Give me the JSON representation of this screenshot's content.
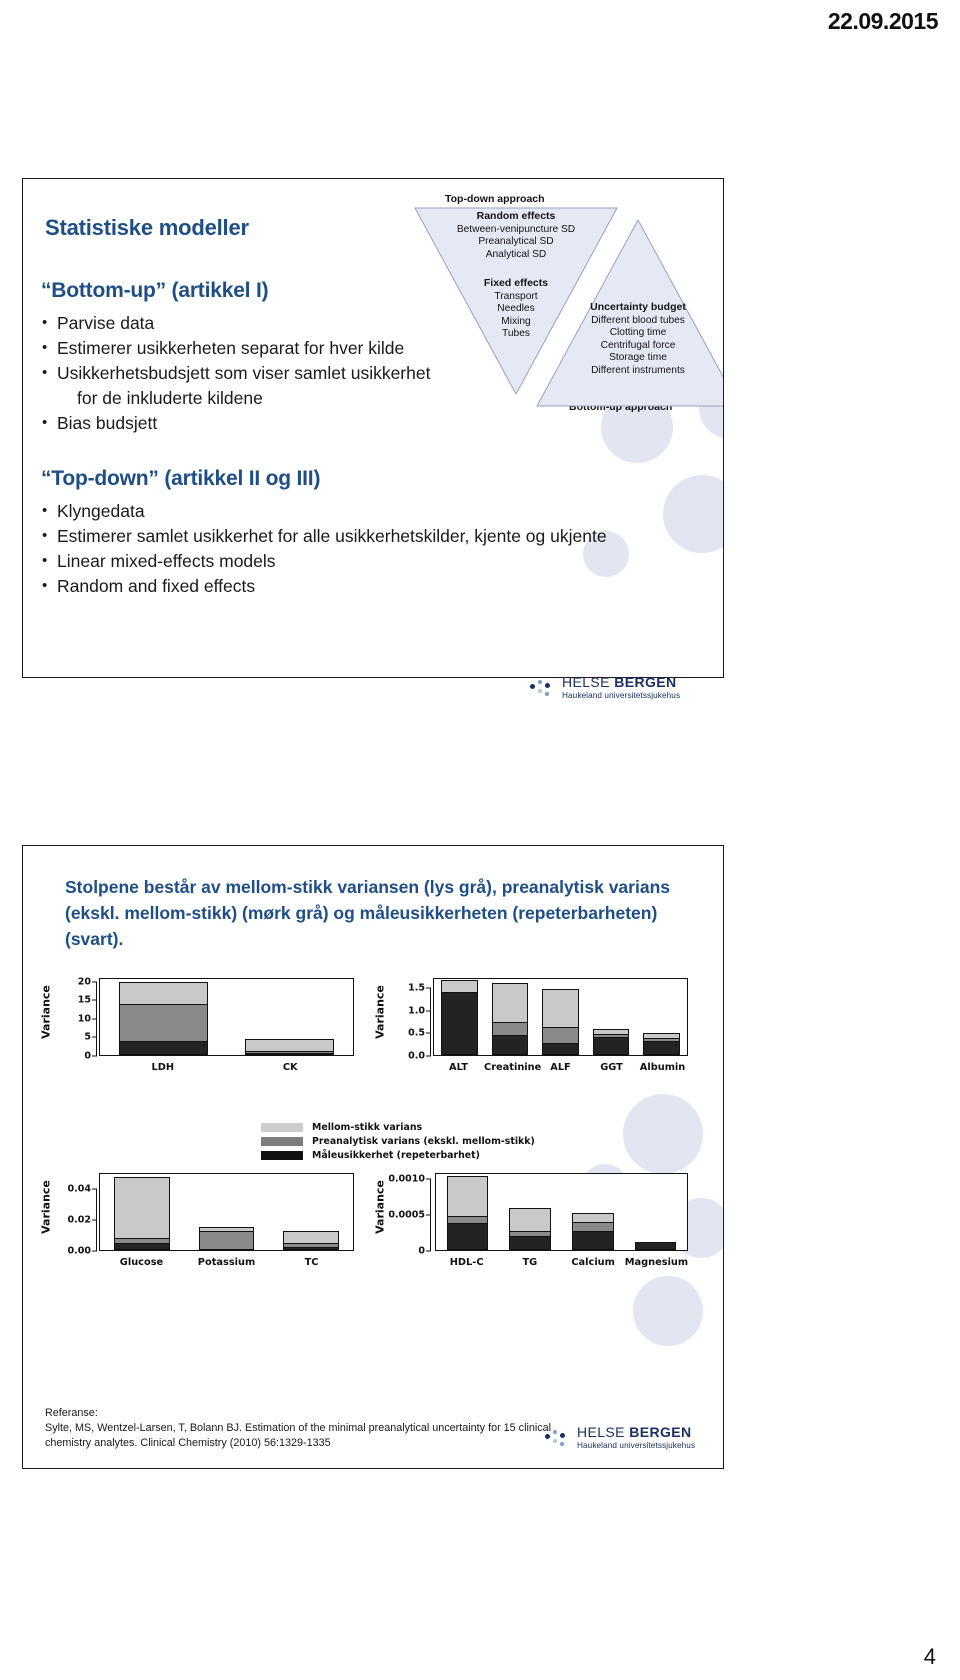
{
  "page": {
    "date": "22.09.2015",
    "number": "4"
  },
  "slide1": {
    "title": "Statistiske modeller",
    "bottom_up": {
      "heading": "“Bottom-up” (artikkel I)",
      "bullets": [
        "Parvise data",
        "Estimerer usikkerheten separat for hver kilde",
        "Usikkerhetsbudsjett som viser samlet usikkerhet",
        "for de inkluderte kildene",
        "Bias budsjett"
      ],
      "continuation_index": 3
    },
    "top_down": {
      "heading": "“Top-down” (artikkel II og III)",
      "bullets": [
        "Klyngedata",
        "Estimerer samlet usikkerhet for alle usikkerhetskilder, kjente og ukjente",
        "Linear mixed-effects models",
        "Random and fixed effects"
      ]
    },
    "diagram": {
      "top_label": "Top-down approach",
      "bottom_label": "Bottom-up approach",
      "random_effects": {
        "heading": "Random effects",
        "items": [
          "Between-venipuncture SD",
          "Preanalytical SD",
          "Analytical SD"
        ]
      },
      "fixed_effects": {
        "heading": "Fixed effects",
        "items": [
          "Transport",
          "Needles",
          "Mixing",
          "Tubes"
        ]
      },
      "uncertainty_budget": {
        "heading": "Uncertainty budget",
        "items": [
          "Different blood tubes",
          "Clotting time",
          "Centrifugal force",
          "Storage time",
          "Different instruments"
        ]
      }
    }
  },
  "slide2": {
    "title": "Stolpene består av mellom-stikk variansen (lys grå), preanalytisk varians (ekskl. mellom-stikk) (mørk grå) og måleusikkerheten (repeterbarheten) (svart).",
    "reference": {
      "label": "Referanse:",
      "citation": "Sylte, MS, Wentzel-Larsen, T, Bolann BJ. Estimation of the minimal preanalytical uncertainty for 15 clinical chemistry analytes. Clinical Chemistry (2010) 56:1329-1335"
    },
    "legend": [
      {
        "color": "#cccccc",
        "label": "Mellom-stikk varians"
      },
      {
        "color": "#7d7d7d",
        "label": "Preanalytisk varians (ekskl. mellom-stikk)"
      },
      {
        "color": "#111111",
        "label": "Måleusikkerhet (repeterbarhet)"
      }
    ]
  },
  "logo": {
    "main_light": "HELSE ",
    "main_bold": "BERGEN",
    "sub": "Haukeland universitetssjukehus",
    "color": "#1b2f63",
    "dot_colors": [
      "#1b2f63",
      "#7f9bc9",
      "#b9c8e0"
    ]
  },
  "chart_data": [
    {
      "id": "chart-1",
      "type": "bar",
      "stacked": true,
      "title": "",
      "xlabel": "",
      "ylabel": "Variance",
      "categories": [
        "LDH",
        "CK"
      ],
      "ylim": [
        0,
        21
      ],
      "yticks": [
        0,
        5,
        10,
        15,
        20
      ],
      "ytick_labels": [
        "0",
        "5",
        "10",
        "15",
        "20"
      ],
      "series": [
        {
          "name": "Måleusikkerhet (repeterbarhet)",
          "color": "#232323",
          "values": [
            3.9,
            0.5
          ]
        },
        {
          "name": "Preanalytisk varians (ekskl. mellom-stikk)",
          "color": "#8a8a8a",
          "values": [
            9.9,
            0.6
          ]
        },
        {
          "name": "Mellom-stikk varians",
          "color": "#c9c9c9",
          "values": [
            5.9,
            3.2
          ]
        }
      ],
      "totals": [
        19.7,
        4.3
      ]
    },
    {
      "id": "chart-2",
      "type": "bar",
      "stacked": true,
      "title": "",
      "xlabel": "",
      "ylabel": "Variance",
      "categories": [
        "ALT",
        "Creatinine",
        "ALF",
        "GGT",
        "Albumin"
      ],
      "ylim": [
        0,
        1.72
      ],
      "yticks": [
        0.0,
        0.5,
        1.0,
        1.5
      ],
      "ytick_labels": [
        "0.0",
        "0.5",
        "1.0",
        "1.5"
      ],
      "series": [
        {
          "name": "Måleusikkerhet (repeterbarhet)",
          "color": "#232323",
          "values": [
            1.4,
            0.45,
            0.26,
            0.4,
            0.31
          ]
        },
        {
          "name": "Preanalytisk varians (ekskl. mellom-stikk)",
          "color": "#8a8a8a",
          "values": [
            0.0,
            0.28,
            0.35,
            0.06,
            0.07
          ]
        },
        {
          "name": "Mellom-stikk varians",
          "color": "#c9c9c9",
          "values": [
            0.25,
            0.86,
            0.84,
            0.12,
            0.1
          ]
        }
      ],
      "totals": [
        1.65,
        1.59,
        1.45,
        0.58,
        0.48
      ]
    },
    {
      "id": "chart-3",
      "type": "bar",
      "stacked": true,
      "title": "",
      "xlabel": "",
      "ylabel": "Variance",
      "categories": [
        "Glucose",
        "Potassium",
        "TC"
      ],
      "ylim": [
        0,
        0.05
      ],
      "yticks": [
        0.0,
        0.02,
        0.04
      ],
      "ytick_labels": [
        "0.00",
        "0.02",
        "0.04"
      ],
      "series": [
        {
          "name": "Måleusikkerhet (repeterbarhet)",
          "color": "#232323",
          "values": [
            0.0045,
            0.0005,
            0.002
          ]
        },
        {
          "name": "Preanalytisk varians (ekskl. mellom-stikk)",
          "color": "#8a8a8a",
          "values": [
            0.0035,
            0.0115,
            0.0025
          ]
        },
        {
          "name": "Mellom-stikk varians",
          "color": "#c9c9c9",
          "values": [
            0.0385,
            0.003,
            0.0075
          ]
        }
      ],
      "totals": [
        0.0465,
        0.015,
        0.012
      ]
    },
    {
      "id": "chart-4",
      "type": "bar",
      "stacked": true,
      "title": "",
      "xlabel": "",
      "ylabel": "Variance",
      "categories": [
        "HDL-C",
        "TG",
        "Calcium",
        "Magnesium"
      ],
      "ylim": [
        0,
        0.00108
      ],
      "yticks": [
        0,
        0.0005,
        0.001
      ],
      "ytick_labels": [
        "0",
        "0.0005",
        "0.0010"
      ],
      "series": [
        {
          "name": "Måleusikkerhet (repeterbarhet)",
          "color": "#232323",
          "values": [
            0.00038,
            0.0002,
            0.00026,
            0.00011
          ]
        },
        {
          "name": "Preanalytisk varians (ekskl. mellom-stikk)",
          "color": "#8a8a8a",
          "values": [
            9e-05,
            6e-05,
            0.00013,
            0.0
          ]
        },
        {
          "name": "Mellom-stikk varians",
          "color": "#c9c9c9",
          "values": [
            0.00055,
            0.00032,
            0.00012,
            0.0
          ]
        }
      ],
      "totals": [
        0.00102,
        0.00058,
        0.00051,
        0.00011
      ]
    }
  ]
}
